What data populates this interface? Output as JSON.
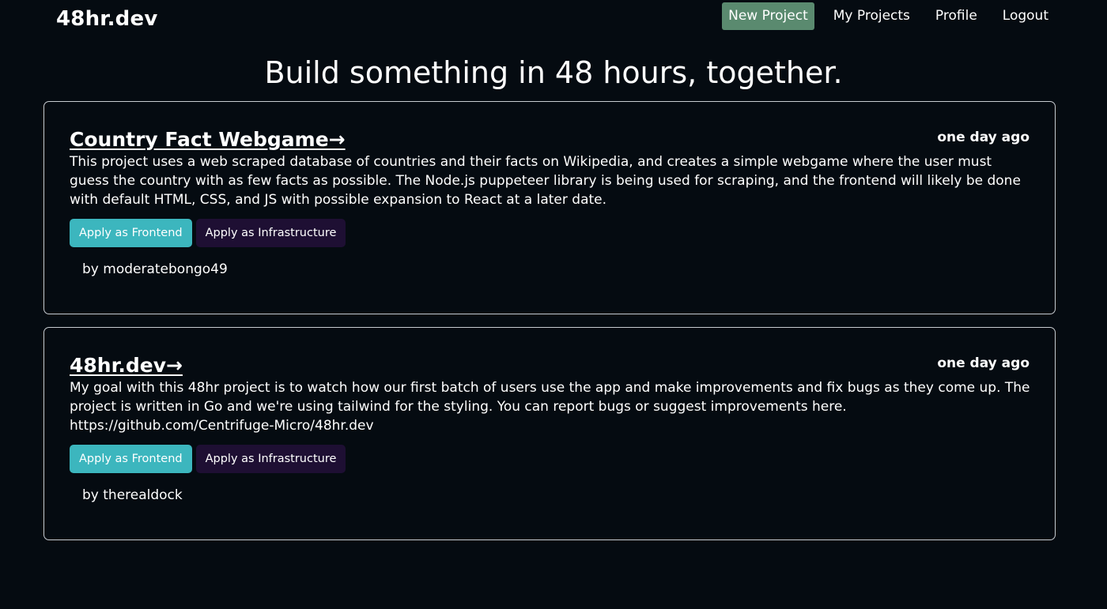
{
  "header": {
    "brand": "48hr.dev",
    "nav": {
      "new_project": "New Project",
      "my_projects": "My Projects",
      "profile": "Profile",
      "logout": "Logout"
    }
  },
  "hero": {
    "title": "Build something in 48 hours, together."
  },
  "projects": [
    {
      "title": "Country Fact Webgame→",
      "time": "one day ago",
      "description": "This project uses a web scraped database of countries and their facts on Wikipedia, and creates a simple webgame where the user must guess the country with as few facts as possible. The Node.js puppeteer library is being used for scraping, and the frontend will likely be done with default HTML, CSS, and JS with possible expansion to React at a later date.",
      "apply_frontend": "Apply as Frontend",
      "apply_infrastructure": "Apply as Infrastructure",
      "author": "by moderatebongo49"
    },
    {
      "title": "48hr.dev→",
      "time": "one day ago",
      "description": "My goal with this 48hr project is to watch how our first batch of users use the app and make improvements and fix bugs as they come up. The project is written in Go and we're using tailwind for the styling. You can report bugs or suggest improvements here. https://github.com/Centrifuge-Micro/48hr.dev",
      "apply_frontend": "Apply as Frontend",
      "apply_infrastructure": "Apply as Infrastructure",
      "author": "by therealdock"
    }
  ],
  "colors": {
    "background": "#050b11",
    "primary_nav": "#5a8a6f",
    "frontend_button": "#3cb6be",
    "infrastructure_button": "#1e0f33",
    "card_border": "#c8ccd0"
  }
}
